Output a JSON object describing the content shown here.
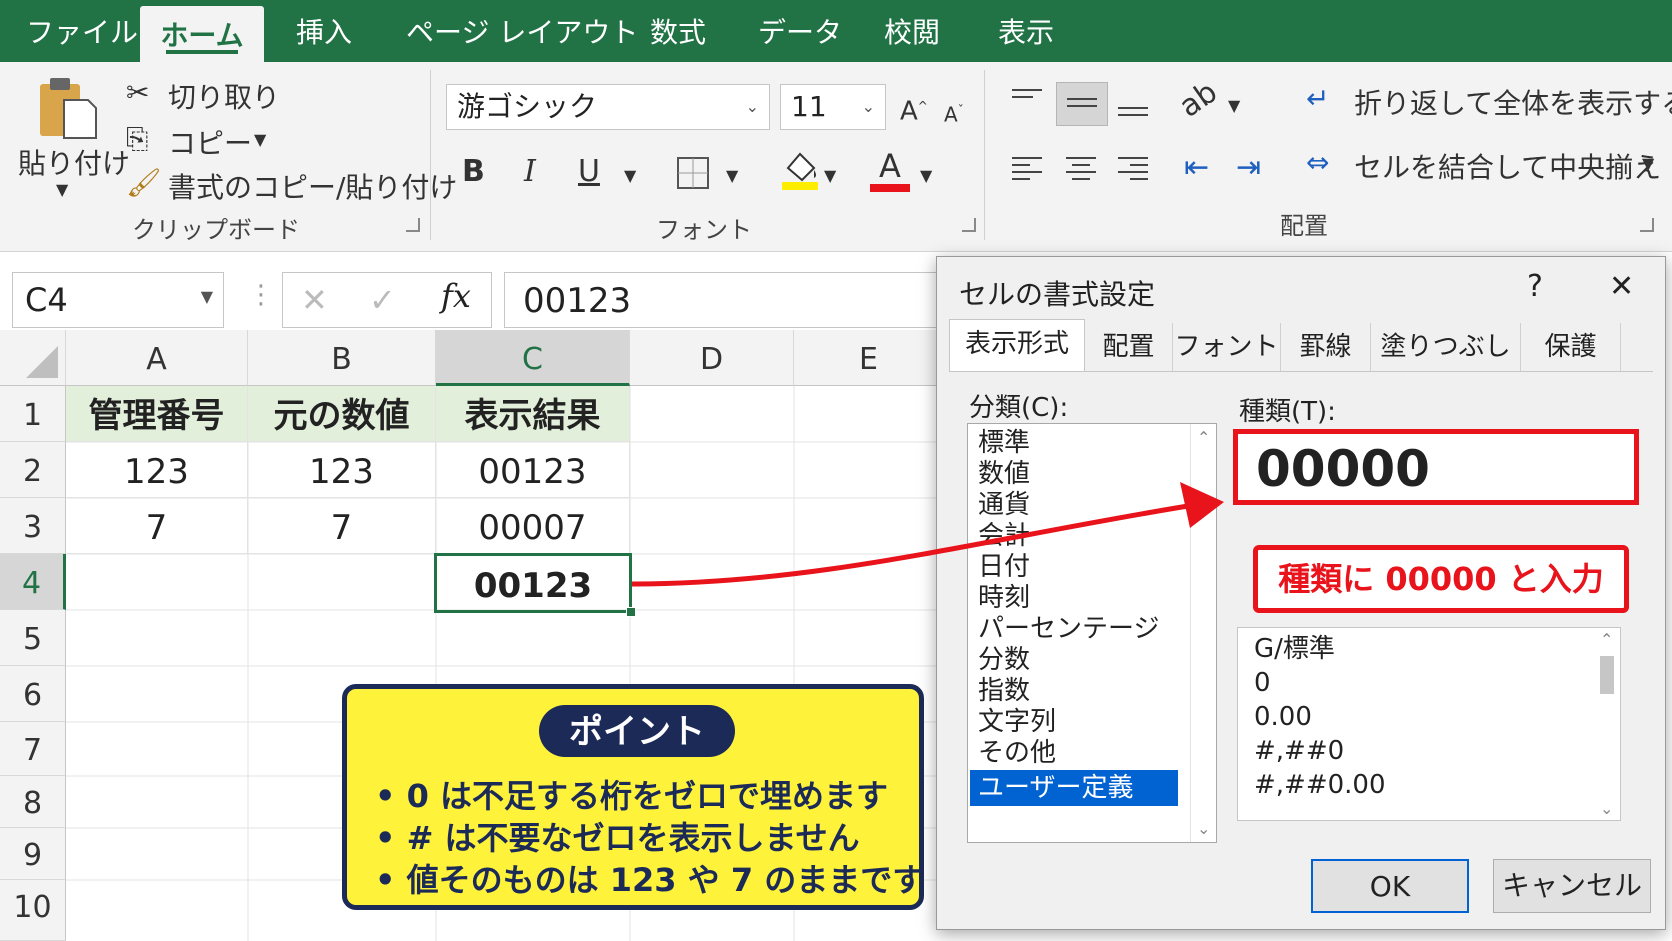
{
  "ribbon_tabs": [
    "ファイル",
    "ホーム",
    "挿入",
    "ページ レイアウト",
    "数式",
    "データ",
    "校閲",
    "表示"
  ],
  "clipboard": {
    "paste": "貼り付け",
    "cut": "切り取り",
    "copy": "コピー",
    "format_painter": "書式のコピー/貼り付け",
    "group": "クリップボード"
  },
  "font": {
    "name": "游ゴシック",
    "size": "11",
    "group": "フォント",
    "bold": "B",
    "italic": "I",
    "underline": "U",
    "font_color_glyph": "A",
    "grow": "A",
    "shrink": "A"
  },
  "alignment": {
    "wrap": "折り返して全体を表示する",
    "merge": "セルを結合して中央揃え",
    "group": "配置"
  },
  "formula_bar": {
    "name_box": "C4",
    "fx": "fx",
    "value": "00123"
  },
  "columns": [
    "A",
    "B",
    "C",
    "D",
    "E"
  ],
  "rows": [
    "1",
    "2",
    "3",
    "4",
    "5",
    "6",
    "7",
    "8",
    "9",
    "10"
  ],
  "cells": {
    "a1": "管理番号",
    "b1": "元の数値",
    "c1": "表示結果",
    "a2": "123",
    "b2": "123",
    "c2": "00123",
    "a3": "7",
    "b3": "7",
    "c3": "00007",
    "c4": "00123"
  },
  "point_box": {
    "title": "ポイント",
    "lines": [
      "• 0 は不足する桁をゼロで埋めます",
      "• # は不要なゼロを表示しません",
      "• 値そのものは 123 や 7 のままです"
    ]
  },
  "dialog": {
    "title": "セルの書式設定",
    "help": "?",
    "close": "✕",
    "tabs": [
      "表示形式",
      "配置",
      "フォント",
      "罫線",
      "塗りつぶし",
      "保護"
    ],
    "category_label": "分類(C):",
    "categories": [
      "標準",
      "数値",
      "通貨",
      "会計",
      "日付",
      "時刻",
      "パーセンテージ",
      "分数",
      "指数",
      "文字列",
      "その他",
      "ユーザー定義"
    ],
    "type_label": "種類(T):",
    "type_value": "00000",
    "annotation": "種類に 00000 と入力",
    "format_list": [
      "G/標準",
      "0",
      "0.00",
      "#,##0",
      "#,##0.00"
    ],
    "ok": "OK",
    "cancel": "キャンセル"
  },
  "colors": {
    "excel_green": "#217346",
    "highlight": "#fff23b",
    "navy": "#1b2a57",
    "red": "#e8131b",
    "selection": "#0063d1"
  }
}
